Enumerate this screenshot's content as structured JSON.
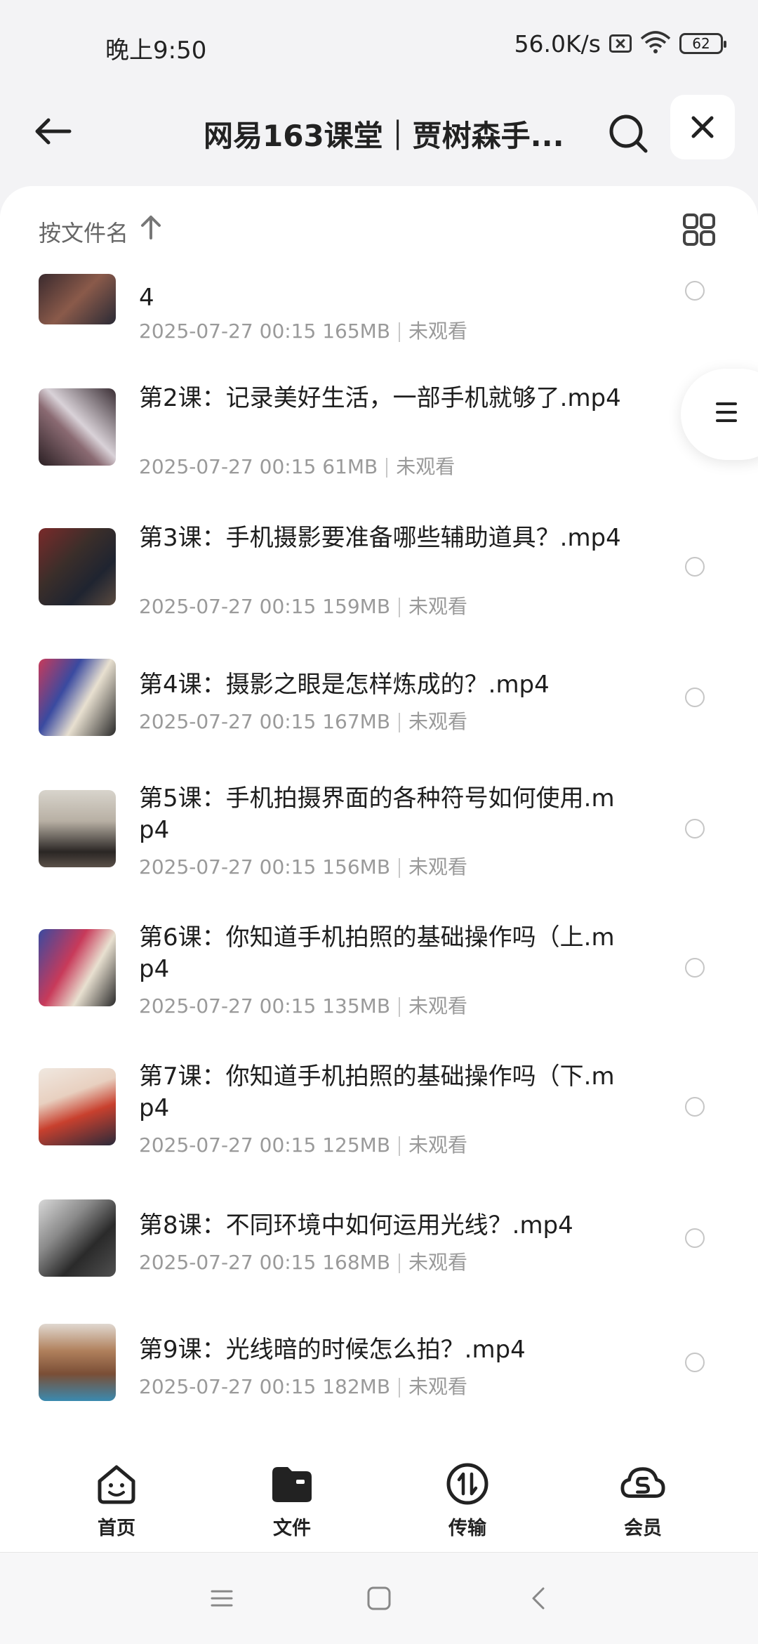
{
  "status": {
    "time": "晚上9:50",
    "speed": "56.0K/s",
    "battery": "62"
  },
  "header": {
    "title": "网易163课堂｜贾树森手..."
  },
  "sort": {
    "label": "按文件名"
  },
  "files": [
    {
      "name": "4",
      "date": "2025-07-27 00:15",
      "size": "165MB",
      "status": "未观看",
      "thumb": "#5a3a3a"
    },
    {
      "name": "第2课：记录美好生活，一部手机就够了.mp4",
      "date": "2025-07-27 00:15",
      "size": "61MB",
      "status": "未观看",
      "thumb": "#6b5a66"
    },
    {
      "name": "第3课：手机摄影要准备哪些辅助道具？.mp4",
      "date": "2025-07-27 00:15",
      "size": "159MB",
      "status": "未观看",
      "thumb": "#4a3c36"
    },
    {
      "name": "第4课：摄影之眼是怎样炼成的？.mp4",
      "date": "2025-07-27 00:15",
      "size": "167MB",
      "status": "未观看",
      "thumb": "#8b4a6a"
    },
    {
      "name": "第5课：手机拍摄界面的各种符号如何使用.mp4",
      "date": "2025-07-27 00:15",
      "size": "156MB",
      "status": "未观看",
      "thumb": "#b8b2a8"
    },
    {
      "name": "第6课：你知道手机拍照的基础操作吗（上.mp4",
      "date": "2025-07-27 00:15",
      "size": "135MB",
      "status": "未观看",
      "thumb": "#7a3e5e"
    },
    {
      "name": "第7课：你知道手机拍照的基础操作吗（下.mp4",
      "date": "2025-07-27 00:15",
      "size": "125MB",
      "status": "未观看",
      "thumb": "#c0483a"
    },
    {
      "name": "第8课：不同环境中如何运用光线？.mp4",
      "date": "2025-07-27 00:15",
      "size": "168MB",
      "status": "未观看",
      "thumb": "#3a3a3a"
    },
    {
      "name": "第9课：光线暗的时候怎么拍？.mp4",
      "date": "2025-07-27 00:15",
      "size": "182MB",
      "status": "未观看",
      "thumb": "#a07256"
    }
  ],
  "nav": [
    {
      "label": "首页",
      "icon": "home-smile-icon"
    },
    {
      "label": "文件",
      "icon": "folder-icon"
    },
    {
      "label": "传输",
      "icon": "transfer-icon"
    },
    {
      "label": "会员",
      "icon": "vip-cloud-icon"
    }
  ]
}
